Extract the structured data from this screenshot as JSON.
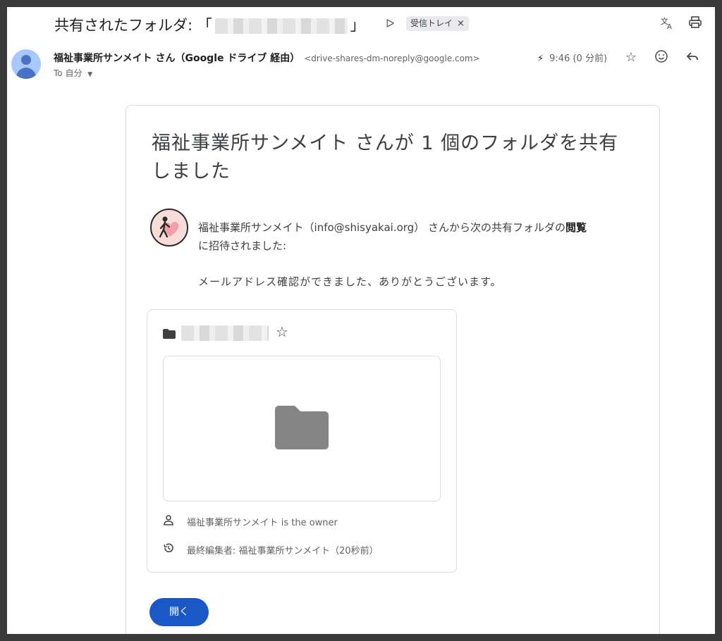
{
  "email": {
    "subject_prefix": "共有されたフォルダ: 「",
    "subject_suffix": "」",
    "label": "受信トレイ",
    "label_close": "×",
    "sender_name": "福祉事業所サンメイト さん（Google ドライブ 経由）",
    "sender_email": "<drive-shares-dm-noreply@google.com>",
    "to_text": "To 自分",
    "time": "9:46 (0 分前)"
  },
  "card": {
    "title": "福祉事業所サンメイト さんが 1 個のフォルダを共有しました",
    "invite_prefix": "福祉事業所サンメイト（info@shisyakai.org） さんから次の共有フォルダの",
    "invite_bold": "閲覧",
    "invite_suffix": "に招待されました:",
    "message": "メールアドレス確認ができました、ありがとうございます。",
    "owner_text": "福祉事業所サンメイト is the owner",
    "last_edited": "最終編集者: 福祉事業所サンメイト（20秒前）",
    "open_button": "開く"
  },
  "icons": {
    "translate": "translate-icon",
    "print": "print-icon",
    "star": "star-icon",
    "emoji": "emoji-icon",
    "reply": "reply-icon",
    "important": "important-icon",
    "lightning": "lightning-icon",
    "folder": "folder-icon",
    "person": "person-icon",
    "history": "history-icon"
  },
  "colors": {
    "primary_button": "#1a57c7",
    "folder_gray": "#858585",
    "avatar_bg": "#a8c7fa"
  }
}
